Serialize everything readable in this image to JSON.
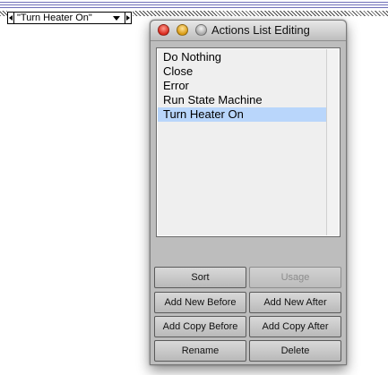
{
  "enum_control": {
    "value": "\"Turn Heater On\"",
    "increment_icon": "triangle-right-icon",
    "decrement_icon": "triangle-left-icon",
    "dropdown_icon": "dropdown-arrow-icon"
  },
  "window": {
    "title": "Actions List Editing",
    "traffic_lights": [
      "close",
      "minimize",
      "zoom"
    ]
  },
  "list": {
    "items": [
      {
        "label": "Do Nothing",
        "selected": false
      },
      {
        "label": "Close",
        "selected": false
      },
      {
        "label": "Error",
        "selected": false
      },
      {
        "label": "Run State Machine",
        "selected": false
      },
      {
        "label": "Turn Heater On",
        "selected": true
      }
    ]
  },
  "buttons": {
    "sort": "Sort",
    "usage": "Usage",
    "add_new_before": "Add New Before",
    "add_new_after": "Add New After",
    "add_copy_before": "Add Copy Before",
    "add_copy_after": "Add Copy After",
    "rename": "Rename",
    "delete": "Delete"
  },
  "colors": {
    "selection": "#b9d6fb",
    "wire": "#6f6fb8",
    "window_bg": "#bdbdbd"
  }
}
